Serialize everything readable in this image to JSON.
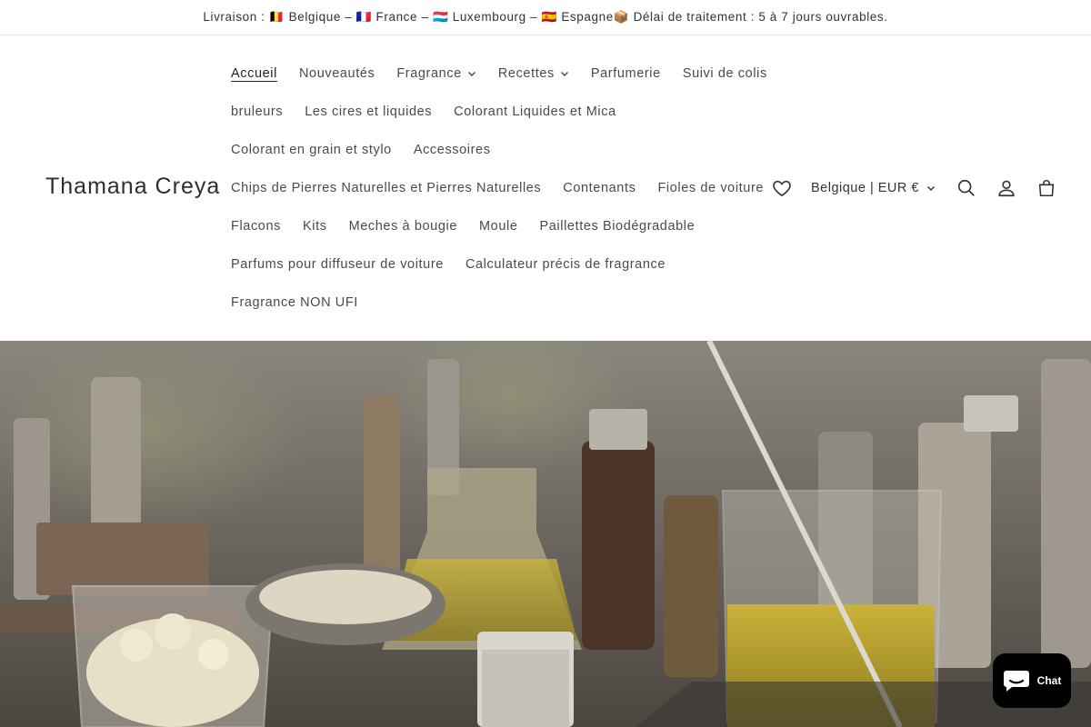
{
  "announcement": {
    "text": "Livraison : 🇧🇪 Belgique – 🇫🇷 France – 🇱🇺 Luxembourg – 🇪🇸 Espagne📦 Délai de traitement : 5 à 7 jours ouvrables."
  },
  "header": {
    "logo": "Thamana Creya",
    "nav_rows": [
      [
        {
          "label": "Accueil",
          "active": true,
          "dropdown": false
        },
        {
          "label": "Nouveautés",
          "dropdown": false
        },
        {
          "label": "Fragrance",
          "dropdown": true
        },
        {
          "label": "Recettes",
          "dropdown": true
        },
        {
          "label": "Parfumerie",
          "dropdown": false
        },
        {
          "label": "Suivi de colis",
          "dropdown": false
        }
      ],
      [
        {
          "label": "bruleurs",
          "dropdown": false
        },
        {
          "label": "Les cires et liquides",
          "dropdown": false
        },
        {
          "label": "Colorant Liquides et Mica",
          "dropdown": false
        }
      ],
      [
        {
          "label": "Colorant en grain et stylo",
          "dropdown": false
        },
        {
          "label": "Accessoires",
          "dropdown": false
        }
      ],
      [
        {
          "label": "Chips de Pierres Naturelles et Pierres Naturelles",
          "dropdown": false
        },
        {
          "label": "Contenants",
          "dropdown": false
        },
        {
          "label": "Fioles de voiture",
          "dropdown": false
        }
      ],
      [
        {
          "label": "Flacons",
          "dropdown": false
        },
        {
          "label": "Kits",
          "dropdown": false
        },
        {
          "label": "Meches à bougie",
          "dropdown": false
        },
        {
          "label": "Moule",
          "dropdown": false
        },
        {
          "label": "Paillettes Biodégradable",
          "dropdown": false
        }
      ],
      [
        {
          "label": "Parfums pour diffuseur de voiture",
          "dropdown": false
        },
        {
          "label": "Calculateur précis de fragrance",
          "dropdown": false
        }
      ],
      [
        {
          "label": "Fragrance NON UFI",
          "dropdown": false
        }
      ]
    ],
    "country_selector": "Belgique | EUR €",
    "icons": [
      "heart-icon",
      "search-icon",
      "account-icon",
      "cart-icon"
    ]
  },
  "chat": {
    "label": "Chat"
  }
}
